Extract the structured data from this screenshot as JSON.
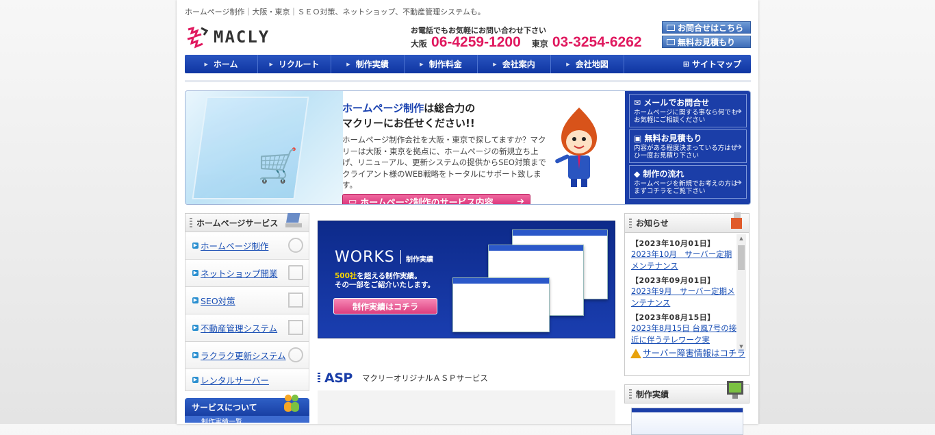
{
  "header": {
    "tagline": "ホームページ制作｜大阪・東京｜ＳＥＯ対策、ネットショップ、不動産管理システムも。",
    "logo_text": "MACLY",
    "contact_lead": "お電話でもお気軽にお問い合わせ下さい",
    "phones": [
      {
        "city": "大阪",
        "number": "06-4259-1200"
      },
      {
        "city": "東京",
        "number": "03-3254-6262"
      }
    ],
    "buttons": {
      "inquiry": "お問合せはこちら",
      "estimate": "無料お見積もり"
    }
  },
  "gnav": {
    "items": [
      "ホーム",
      "リクルート",
      "制作実績",
      "制作料金",
      "会社案内",
      "会社地図"
    ],
    "sitemap": "サイトマップ"
  },
  "hero": {
    "title_hl": "ホームページ制作",
    "title_rest1": "は総合力の",
    "title_line2": "マクリーにお任せください!!",
    "body": "ホームページ制作会社を大阪・東京で探してますか？マクリーは大阪・東京を拠点に、ホームページの新規立ち上げ、リニューアル、更新システムの提供からSEO対策までクライアント様のWEB戦略をトータルにサポート致します。",
    "button": "ホームページ制作のサービス内容",
    "side": [
      {
        "title": "メールでお問合せ",
        "desc": "ホームページに関する事なら何でもお気軽にご相談ください"
      },
      {
        "title": "無料お見積もり",
        "desc": "内容がある程度決まっている方はぜひ一度お見積り下さい"
      },
      {
        "title": "制作の流れ",
        "desc": "ホームページを新規でお考えの方はまずコチラをご覧下さい"
      }
    ]
  },
  "services": {
    "heading": "ホームページサービス",
    "items": [
      "ホームページ制作",
      "ネットショップ開業",
      "SEO対策",
      "不動産管理システム",
      "ラクラク更新システム",
      "レンタルサーバー"
    ],
    "about_heading": "サービスについて",
    "about_sub": "制作実績一覧"
  },
  "works": {
    "title": "WORKS",
    "sub": "制作実績",
    "count": "500社",
    "line1_rest": "を超える制作実績。",
    "line2": "その一部をご紹介いたします。",
    "button": "制作実績はコチラ"
  },
  "asp": {
    "title": "ASP",
    "sub": "マクリーオリジナルＡＳＰサービス"
  },
  "news": {
    "heading": "お知らせ",
    "items": [
      {
        "date": "【2023年10月01日】",
        "text": "2023年10月　サーバー定期メンテナンス"
      },
      {
        "date": "【2023年09月01日】",
        "text": "2023年9月　サーバー定期メンテナンス"
      },
      {
        "date": "【2023年08月15日】",
        "text": "2023年8月15日 台風7号の接近に伴うテレワーク実"
      }
    ],
    "alert": "サーバー障害情報はコチラ"
  },
  "side_works": {
    "heading": "制作実績"
  },
  "colors": {
    "brand_blue": "#1b3ea8",
    "phone_pink": "#e0195f",
    "link_blue": "#1a4fb5"
  }
}
